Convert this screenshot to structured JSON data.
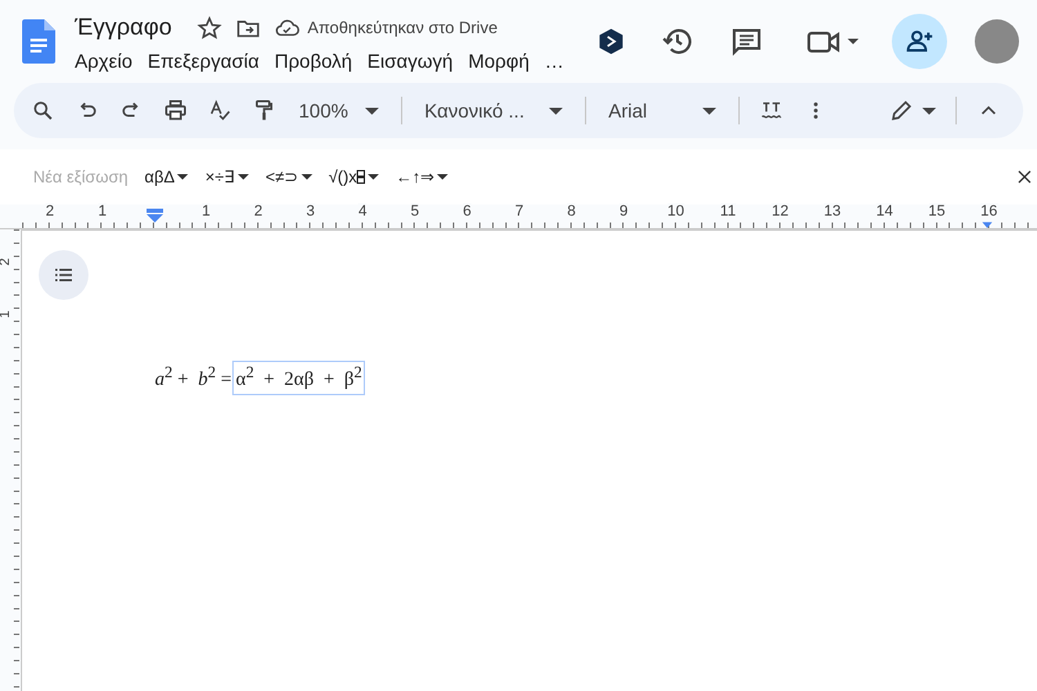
{
  "document": {
    "title": "Έγγραφο",
    "save_status": "Αποθηκεύτηκαν στο Drive"
  },
  "menus": [
    "Αρχείο",
    "Επεξεργασία",
    "Προβολή",
    "Εισαγωγή",
    "Μορφή",
    "…"
  ],
  "toolbar": {
    "zoom": "100%",
    "paragraph_style": "Κανονικό ...",
    "font": "Arial"
  },
  "equation_bar": {
    "new_equation": {
      "label": "Νέα εξίσωση",
      "disabled": true
    },
    "menus": [
      {
        "label": "αβΔ",
        "kind": "text"
      },
      {
        "label": "×÷∃",
        "kind": "text"
      },
      {
        "label": "<≠⊃",
        "kind": "text"
      },
      {
        "label": "√()x",
        "kind": "scripts"
      },
      {
        "label": "←↑⇒",
        "kind": "text"
      }
    ]
  },
  "ruler": {
    "labels": [
      "2",
      "1",
      "1",
      "2",
      "3",
      "4",
      "5",
      "6",
      "7",
      "8",
      "9",
      "10",
      "11",
      "12",
      "13",
      "14",
      "15",
      "16"
    ]
  },
  "vertical_ruler": {
    "labels": [
      "2",
      "1"
    ]
  },
  "equation": {
    "left": "*a*$^{2}$ +  *b*$^{2}$ =",
    "right": "α$^{2}$  +  2αβ  +  β$^{2}$"
  }
}
